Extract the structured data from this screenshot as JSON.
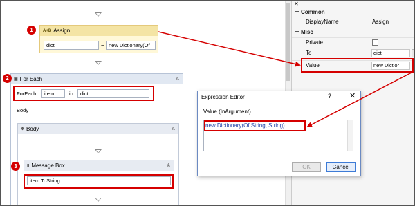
{
  "designer": {
    "assign": {
      "badge": "1",
      "icon_text": "A+B",
      "title": "Assign",
      "to_value": "dict",
      "equals": "=",
      "value": "new Dictionary(Of"
    },
    "foreach": {
      "badge": "2",
      "title": "For Each",
      "collapse_glyph": "⩓",
      "foreach_label": "ForEach",
      "item_value": "item",
      "in_label": "in",
      "collection_value": "dict",
      "body_label": "Body"
    },
    "body": {
      "title": "Body",
      "collapse_glyph": "⩓"
    },
    "message_box": {
      "badge": "3",
      "title": "Message Box",
      "collapse_glyph": "⩓",
      "text_value": "item.ToString"
    }
  },
  "properties": {
    "close_glyph": "✕",
    "groups": [
      {
        "name": "Common",
        "rows": [
          {
            "name": "DisplayName",
            "value": "Assign"
          }
        ]
      },
      {
        "name": "Misc",
        "rows": [
          {
            "name": "Private",
            "value": ""
          },
          {
            "name": "To",
            "value": "dict"
          },
          {
            "name": "Value",
            "value": "new Dictior"
          }
        ]
      }
    ]
  },
  "dialog": {
    "title": "Expression Editor",
    "help": "?",
    "close": "✕",
    "label": "Value (InArgument)",
    "expression": "new Dictionary(Of String, String)",
    "ok_label": "OK",
    "cancel_label": "Cancel"
  },
  "colors": {
    "annotation_red": "#d50000",
    "assign_header": "#f4e4a4",
    "activity_header": "#e1e8f2"
  }
}
